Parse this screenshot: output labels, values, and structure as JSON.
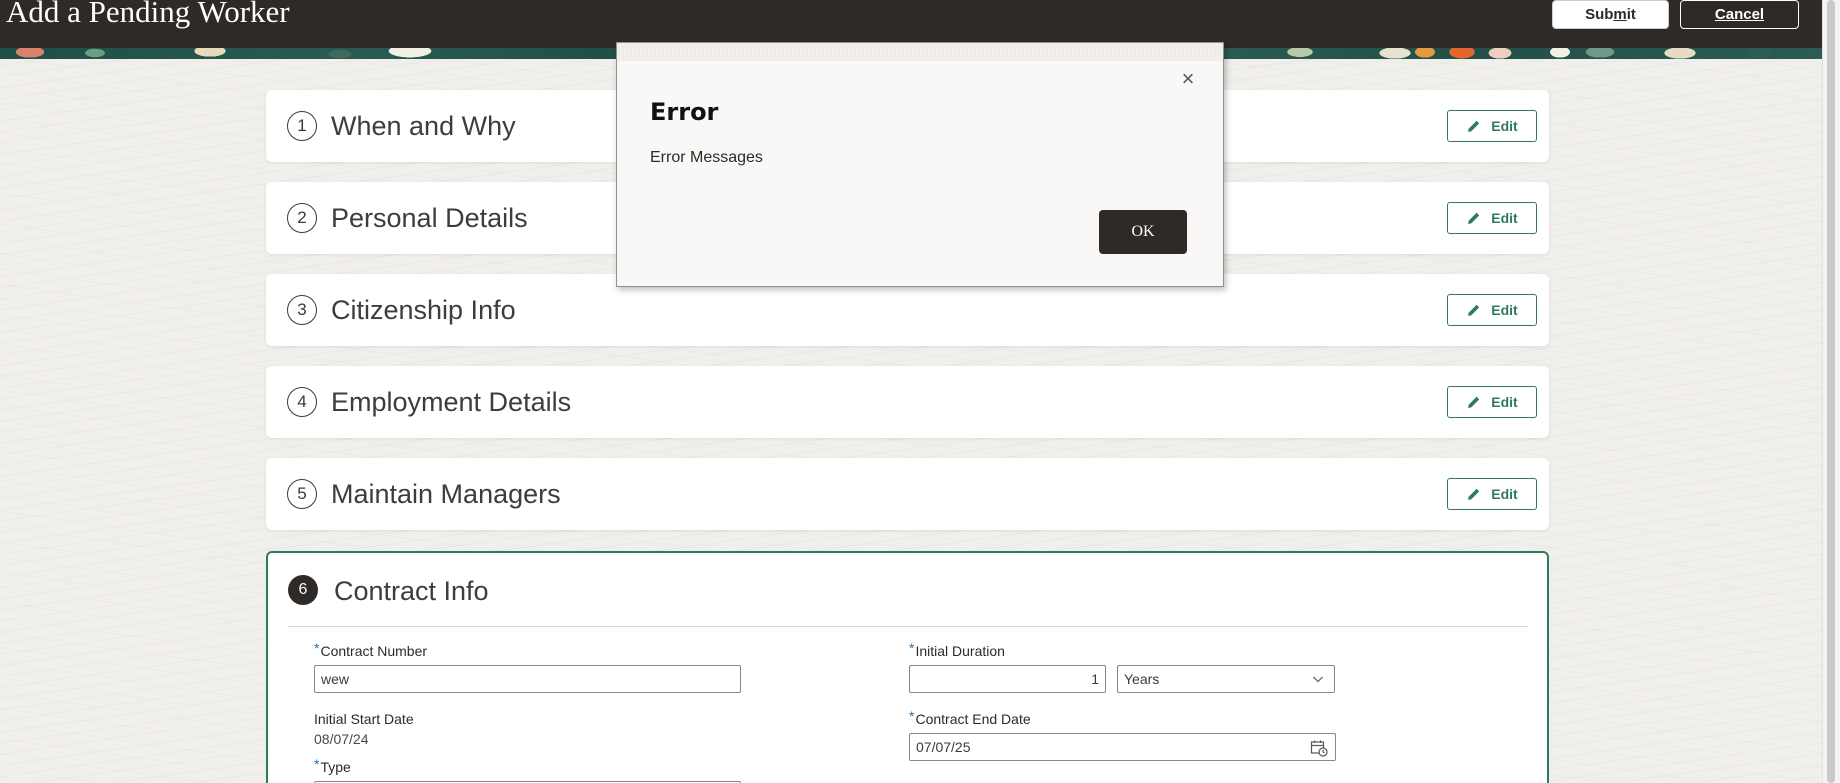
{
  "header": {
    "title": "Add a Pending Worker",
    "submit_label_pre": "Sub",
    "submit_label_u": "m",
    "submit_label_post": "it",
    "cancel_label": "Cancel"
  },
  "sections": [
    {
      "number": "1",
      "title": "When and Why",
      "edit_label": "Edit"
    },
    {
      "number": "2",
      "title": "Personal Details",
      "edit_label": "Edit"
    },
    {
      "number": "3",
      "title": "Citizenship Info",
      "edit_label": "Edit"
    },
    {
      "number": "4",
      "title": "Employment Details",
      "edit_label": "Edit"
    },
    {
      "number": "5",
      "title": "Maintain Managers",
      "edit_label": "Edit"
    }
  ],
  "active_section": {
    "number": "6",
    "title": "Contract Info",
    "contract_number_label": "Contract Number",
    "contract_number_value": "wew",
    "initial_start_date_label": "Initial Start Date",
    "initial_start_date_value": "08/07/24",
    "type_label": "Type",
    "initial_duration_label": "Initial Duration",
    "initial_duration_value": "1",
    "duration_unit_value": "Years",
    "contract_end_date_label": "Contract End Date",
    "contract_end_date_value": "07/07/25",
    "required_marker": "*"
  },
  "dialog": {
    "title": "Error",
    "message": "Error Messages",
    "ok_label": "OK",
    "close_glyph": "×"
  },
  "icons": {
    "edit": "pencil-icon",
    "close": "close-icon",
    "chevron": "chevron-down-icon",
    "calendar": "calendar-icon"
  },
  "colors": {
    "header_bg": "#2d2a27",
    "accent_green": "#2f7a5f",
    "required_blue": "#1f6fb6"
  }
}
